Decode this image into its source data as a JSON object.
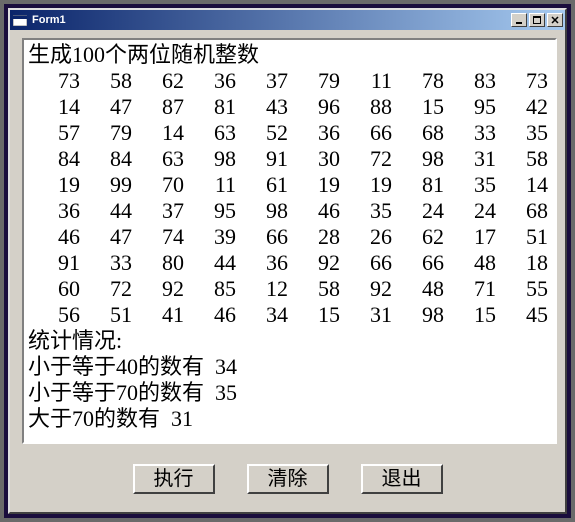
{
  "window": {
    "title": "Form1"
  },
  "titlebar_buttons": {
    "minimize": "_",
    "maximize": "□",
    "close": "×"
  },
  "content": {
    "heading": "生成100个两位随机整数",
    "grid": [
      [
        73,
        58,
        62,
        36,
        37,
        79,
        11,
        78,
        83,
        73
      ],
      [
        14,
        47,
        87,
        81,
        43,
        96,
        88,
        15,
        95,
        42
      ],
      [
        57,
        79,
        14,
        63,
        52,
        36,
        66,
        68,
        33,
        35
      ],
      [
        84,
        84,
        63,
        98,
        91,
        30,
        72,
        98,
        31,
        58
      ],
      [
        19,
        99,
        70,
        11,
        61,
        19,
        19,
        81,
        35,
        14
      ],
      [
        36,
        44,
        37,
        95,
        98,
        46,
        35,
        24,
        24,
        68
      ],
      [
        46,
        47,
        74,
        39,
        66,
        28,
        26,
        62,
        17,
        51
      ],
      [
        91,
        33,
        80,
        44,
        36,
        92,
        66,
        66,
        48,
        18
      ],
      [
        60,
        72,
        92,
        85,
        12,
        58,
        92,
        48,
        71,
        55
      ],
      [
        56,
        51,
        41,
        46,
        34,
        15,
        31,
        98,
        15,
        45
      ]
    ],
    "stats_heading": "统计情况:",
    "stats": [
      {
        "label": "小于等于40的数有",
        "value": 34
      },
      {
        "label": "小于等于70的数有",
        "value": 35
      },
      {
        "label": "大于70的数有",
        "value": 31
      }
    ]
  },
  "buttons": {
    "execute": "执行",
    "clear": "清除",
    "exit": "退出"
  }
}
